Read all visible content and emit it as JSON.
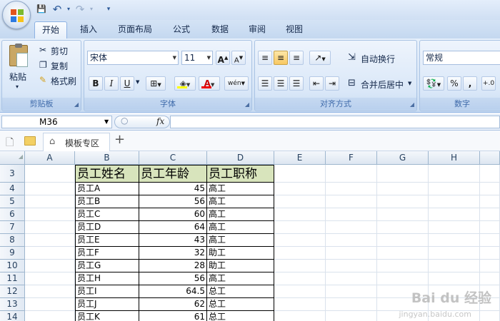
{
  "qat": {
    "save": "💾",
    "undo": "↶",
    "redo": "↷",
    "more": "▾"
  },
  "tabs": [
    "开始",
    "插入",
    "页面布局",
    "公式",
    "数据",
    "审阅",
    "视图"
  ],
  "clipboard": {
    "paste": "粘贴",
    "cut": "剪切",
    "copy": "复制",
    "format_painter": "格式刷",
    "label": "剪贴板"
  },
  "font": {
    "name": "宋体",
    "size": "11",
    "grow": "A",
    "shrink": "A",
    "bold": "B",
    "italic": "I",
    "underline": "U",
    "wen": "wén",
    "label": "字体"
  },
  "alignment": {
    "wrap": "自动换行",
    "merge": "合并后居中",
    "label": "对齐方式"
  },
  "number": {
    "format": "常规",
    "percent": "%",
    "comma": ",",
    "label": "数字"
  },
  "formula_bar": {
    "cell_ref": "M36",
    "fx": "fx",
    "value": ""
  },
  "doc_tabs": {
    "template": "模板专区",
    "add": "+"
  },
  "columns": [
    "A",
    "B",
    "C",
    "D",
    "E",
    "F",
    "G",
    "H"
  ],
  "rows": [
    {
      "n": "3",
      "name": "员工姓名",
      "age": "员工年龄",
      "title": "员工职称"
    },
    {
      "n": "4",
      "name": "员工A",
      "age": "45",
      "title": "高工"
    },
    {
      "n": "5",
      "name": "员工B",
      "age": "56",
      "title": "高工"
    },
    {
      "n": "6",
      "name": "员工C",
      "age": "60",
      "title": "高工"
    },
    {
      "n": "7",
      "name": "员工D",
      "age": "64",
      "title": "高工"
    },
    {
      "n": "8",
      "name": "员工E",
      "age": "43",
      "title": "高工"
    },
    {
      "n": "9",
      "name": "员工F",
      "age": "32",
      "title": "助工"
    },
    {
      "n": "10",
      "name": "员工G",
      "age": "28",
      "title": "助工"
    },
    {
      "n": "11",
      "name": "员工H",
      "age": "56",
      "title": "高工"
    },
    {
      "n": "12",
      "name": "员工I",
      "age": "64.5",
      "title": "总工"
    },
    {
      "n": "13",
      "name": "员工J",
      "age": "62",
      "title": "总工"
    },
    {
      "n": "14",
      "name": "员工K",
      "age": "61",
      "title": "总工"
    }
  ],
  "watermark": {
    "brand": "Bai du 经验",
    "url": "jingyan.baidu.com"
  }
}
